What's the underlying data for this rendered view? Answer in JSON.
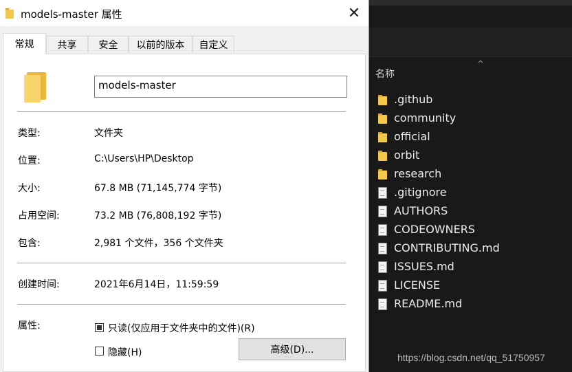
{
  "dialog": {
    "title": "models-master 属性",
    "close_glyph": "✕",
    "tabs": [
      "常规",
      "共享",
      "安全",
      "以前的版本",
      "自定义"
    ],
    "active_tab": 0,
    "name_value": "models-master",
    "rows": [
      {
        "label": "类型:",
        "value": "文件夹"
      },
      {
        "label": "位置:",
        "value": "C:\\Users\\HP\\Desktop"
      },
      {
        "label": "大小:",
        "value": "67.8 MB (71,145,774 字节)"
      },
      {
        "label": "占用空间:",
        "value": "73.2 MB (76,808,192 字节)"
      },
      {
        "label": "包含:",
        "value": "2,981 个文件，356 个文件夹"
      },
      {
        "label": "创建时间:",
        "value": "2021年6月14日，11:59:59"
      }
    ],
    "attributes_label": "属性:",
    "readonly_label": "只读(仅应用于文件夹中的文件)(R)",
    "readonly_state": "indeterminate",
    "hidden_label": "隐藏(H)",
    "hidden_checked": false,
    "advanced_button": "高级(D)..."
  },
  "explorer": {
    "sort_caret": "^",
    "column_header": "名称",
    "items": [
      {
        "name": ".github",
        "icon": "folder-icon"
      },
      {
        "name": "community",
        "icon": "folder-icon"
      },
      {
        "name": "official",
        "icon": "folder-icon"
      },
      {
        "name": "orbit",
        "icon": "folder-icon"
      },
      {
        "name": "research",
        "icon": "folder-icon"
      },
      {
        "name": ".gitignore",
        "icon": "file-icon"
      },
      {
        "name": "AUTHORS",
        "icon": "file-icon"
      },
      {
        "name": "CODEOWNERS",
        "icon": "file-icon"
      },
      {
        "name": "CONTRIBUTING.md",
        "icon": "file-icon"
      },
      {
        "name": "ISSUES.md",
        "icon": "file-icon"
      },
      {
        "name": "LICENSE",
        "icon": "file-icon"
      },
      {
        "name": "README.md",
        "icon": "file-icon"
      }
    ],
    "watermark": "https://blog.csdn.net/qq_51750957"
  }
}
